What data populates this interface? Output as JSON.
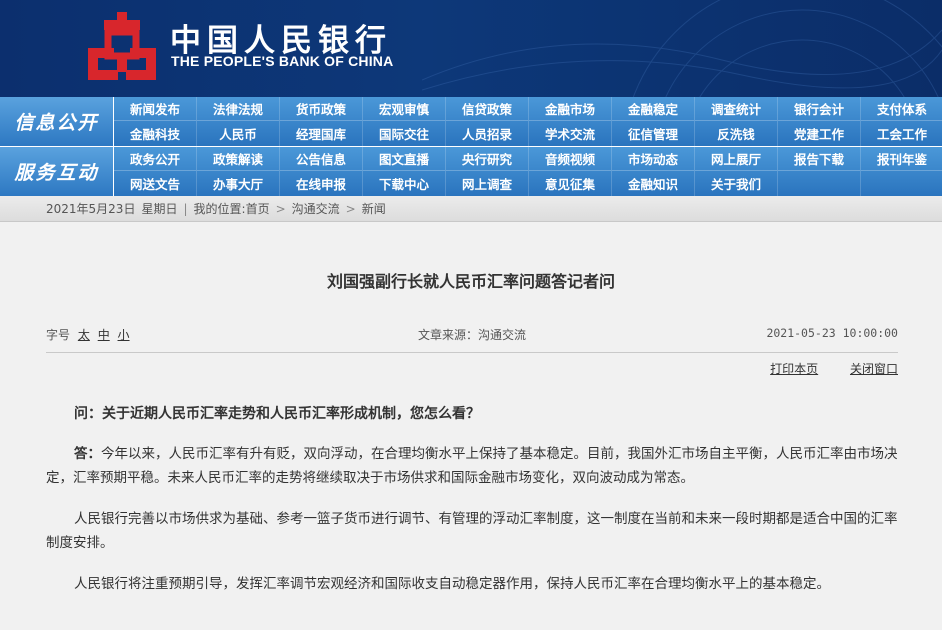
{
  "header": {
    "title_cn": "中国人民银行",
    "title_en": "THE PEOPLE'S BANK OF CHINA"
  },
  "nav": {
    "row1_label": "信息公开",
    "row1_items": [
      "新闻发布",
      "法律法规",
      "货币政策",
      "宏观审慎",
      "信贷政策",
      "金融市场",
      "金融稳定",
      "调查统计",
      "银行会计",
      "支付体系",
      "金融科技",
      "人民币",
      "经理国库",
      "国际交往",
      "人员招录",
      "学术交流",
      "征信管理",
      "反洗钱",
      "党建工作",
      "工会工作"
    ],
    "row2_label": "服务互动",
    "row2_items": [
      "政务公开",
      "政策解读",
      "公告信息",
      "图文直播",
      "央行研究",
      "音频视频",
      "市场动态",
      "网上展厅",
      "报告下载",
      "报刊年鉴",
      "网送文告",
      "办事大厅",
      "在线申报",
      "下载中心",
      "网上调查",
      "意见征集",
      "金融知识",
      "关于我们",
      "",
      ""
    ]
  },
  "breadcrumb": {
    "date": "2021年5月23日",
    "weekday": "星期日",
    "location_label": "我的位置:",
    "home": "首页",
    "section": "沟通交流",
    "page": "新闻"
  },
  "article": {
    "title": "刘国强副行长就人民币汇率问题答记者问",
    "font_size_label": "字号",
    "font_size_options": [
      "太",
      "中",
      "小"
    ],
    "source": "文章来源：沟通交流",
    "date": "2021-05-23 10:00:00",
    "print_label": "打印本页",
    "close_label": "关闭窗口",
    "question": "问：关于近期人民币汇率走势和人民币汇率形成机制，您怎么看？",
    "answer_lead": "答：",
    "answer_p1": "今年以来，人民币汇率有升有贬，双向浮动，在合理均衡水平上保持了基本稳定。目前，我国外汇市场自主平衡，人民币汇率由市场决定，汇率预期平稳。未来人民币汇率的走势将继续取决于市场供求和国际金融市场变化，双向波动成为常态。",
    "answer_p2": "人民银行完善以市场供求为基础、参考一篮子货币进行调节、有管理的浮动汇率制度，这一制度在当前和未来一段时期都是适合中国的汇率制度安排。",
    "answer_p3": "人民银行将注重预期引导，发挥汇率调节宏观经济和国际收支自动稳定器作用，保持人民币汇率在合理均衡水平上的基本稳定。"
  },
  "colors": {
    "header_bg": "#0d3879",
    "logo_red": "#d8262c",
    "nav_blue": "#2d78c2"
  }
}
